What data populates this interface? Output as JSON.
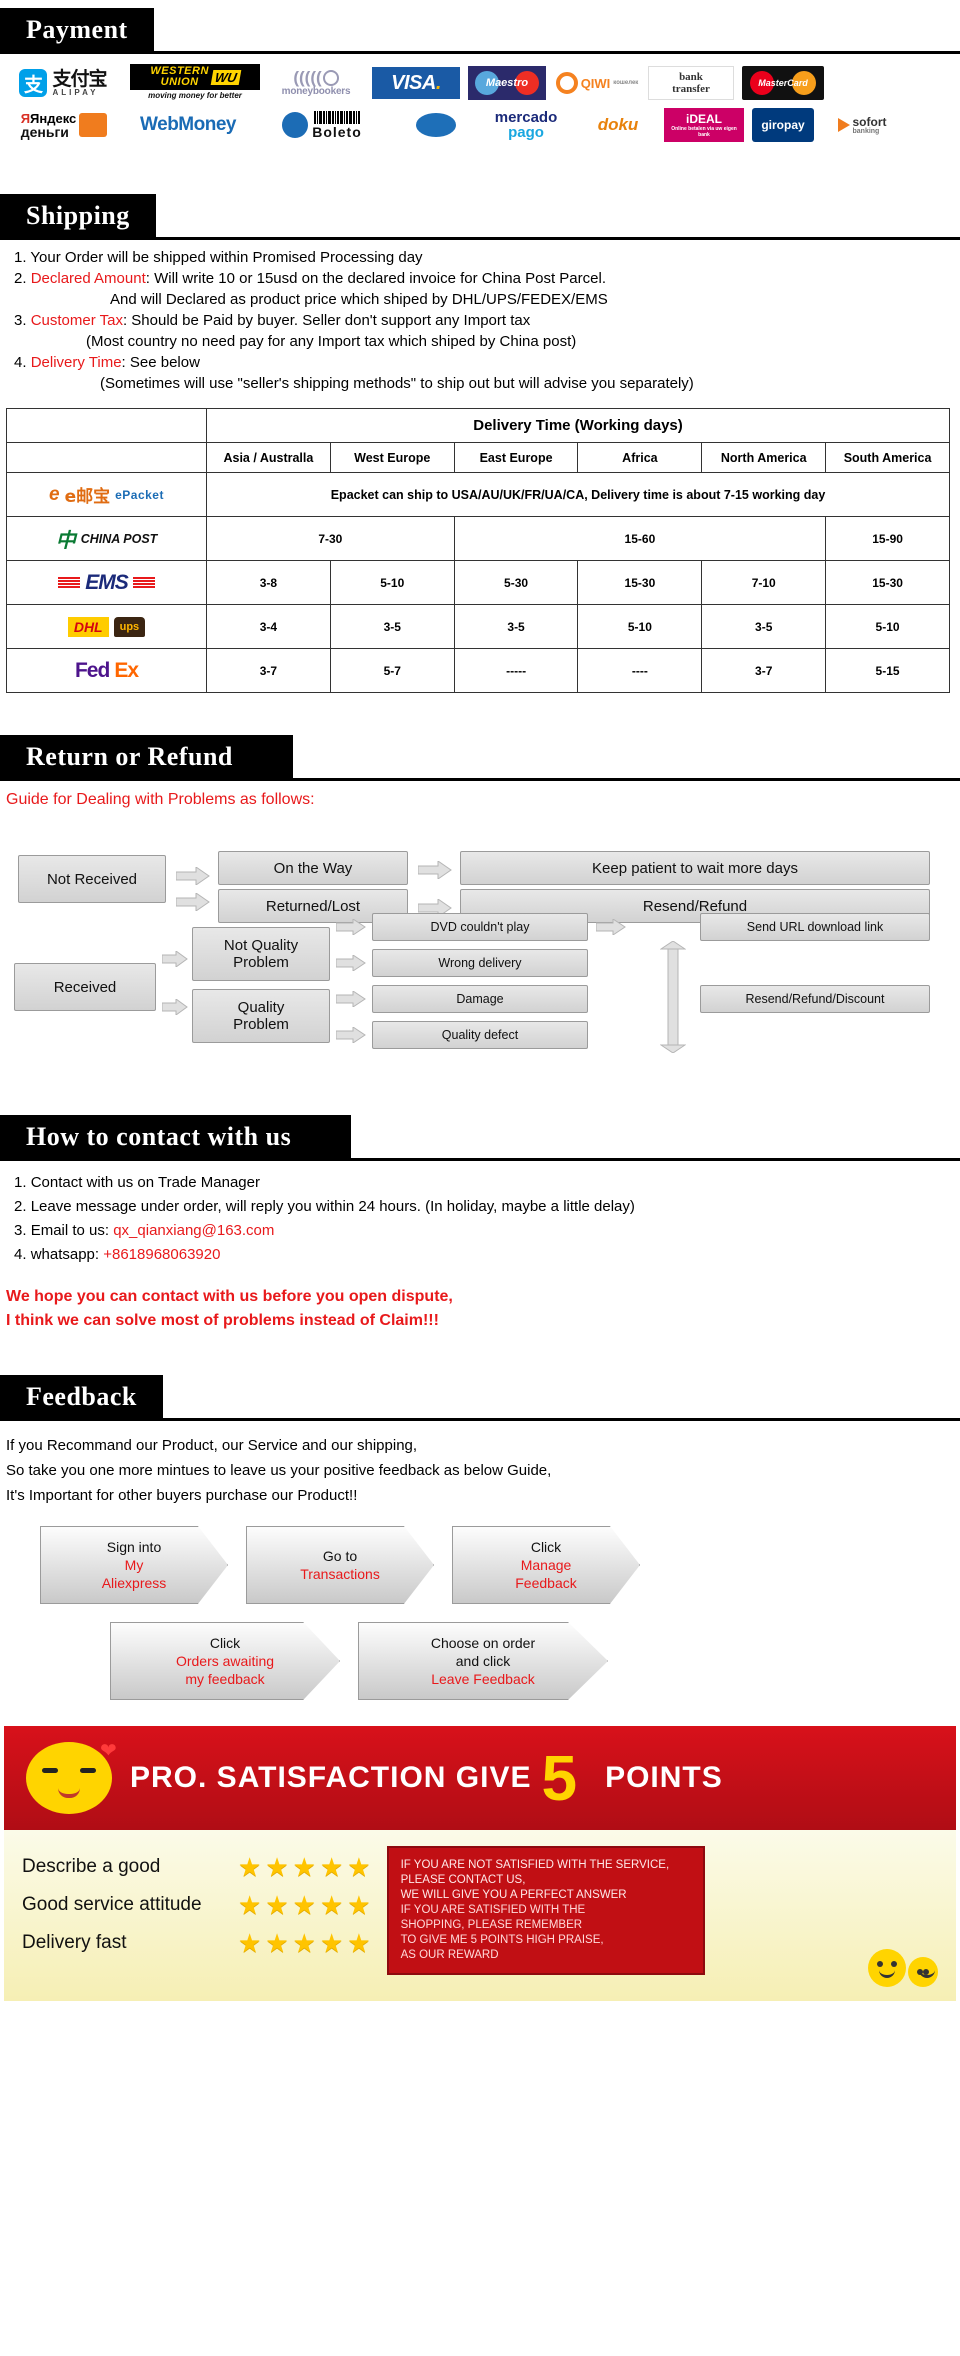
{
  "sections": {
    "payment": {
      "title": "Payment"
    },
    "shipping": {
      "title": "Shipping"
    },
    "return": {
      "title": "Return or Refund"
    },
    "contact": {
      "title": "How to contact with us"
    },
    "feedback": {
      "title": "Feedback"
    }
  },
  "payment": {
    "row1": [
      {
        "name": "alipay",
        "label": "ALIPAY",
        "cn": "支付宝",
        "glyph": "支"
      },
      {
        "name": "western-union",
        "line1": "WESTERN",
        "line2": "UNION",
        "mark": "WU",
        "caption": "moving money for better"
      },
      {
        "name": "moneybookers",
        "label": "moneybookers"
      },
      {
        "name": "visa",
        "label": "VISA"
      },
      {
        "name": "maestro",
        "label": "Maestro"
      },
      {
        "name": "qiwi",
        "label": "QIWI",
        "sub": "кошелек"
      },
      {
        "name": "bank-transfer",
        "line1": "bank",
        "line2": "transfer"
      },
      {
        "name": "mastercard",
        "label": "MasterCard"
      }
    ],
    "row2": [
      {
        "name": "yandex-dengi",
        "line1": "Яндекс",
        "line2": "деньги"
      },
      {
        "name": "webmoney",
        "label": "WebMoney"
      },
      {
        "name": "boleto",
        "label": "Boleto"
      },
      {
        "name": "mercado-pago",
        "line1": "mercado",
        "line2": "pago"
      },
      {
        "name": "doku",
        "label": "doku"
      },
      {
        "name": "ideal",
        "label": "iDEAL",
        "sub": "Online betalen via uw eigen bank"
      },
      {
        "name": "giropay",
        "label": "giropay"
      },
      {
        "name": "sofort",
        "line1": "sofort",
        "line2": "banking"
      }
    ]
  },
  "shipping": {
    "items": [
      {
        "num": "1.",
        "label": "",
        "text": "Your Order will be shipped within Promised Processing day"
      },
      {
        "num": "2.",
        "label": "Declared Amount",
        "text": ": Will write 10 or 15usd on the declared invoice for China Post Parcel."
      },
      {
        "num": "3.",
        "label": "Customer Tax",
        "text": ":  Should be Paid by buyer. Seller don't support any Import tax"
      },
      {
        "num": "4.",
        "label": "Delivery Time",
        "text": ": See below"
      }
    ],
    "sub1": "And will Declared as product price which shiped by DHL/UPS/FEDEX/EMS",
    "sub2": "(Most country no need pay for any Import tax which shiped by China post)",
    "sub3": "(Sometimes will use \"seller's shipping methods\" to ship out but will advise you separately)"
  },
  "delivery_table": {
    "title": "Delivery Time (Working days)",
    "columns": [
      "Asia / Australla",
      "West Europe",
      "East Europe",
      "Africa",
      "North America",
      "South America"
    ],
    "rows": [
      {
        "carrier": "ePacket",
        "carrier_cn": "e邮宝",
        "span_note": "Epacket can ship to USA/AU/UK/FR/UA/CA, Delivery time is about 7-15 working day",
        "values": []
      },
      {
        "carrier": "CHINA POST",
        "values": [
          "7-30",
          "7-30",
          "15-60",
          "15-60",
          "15-60",
          "15-90"
        ],
        "merged": [
          {
            "text": "7-30",
            "span": 2
          },
          {
            "text": "15-60",
            "span": 3
          },
          {
            "text": "15-90",
            "span": 1
          }
        ]
      },
      {
        "carrier": "EMS",
        "values": [
          "3-8",
          "5-10",
          "5-30",
          "15-30",
          "7-10",
          "15-30"
        ]
      },
      {
        "carrier": "DHL / UPS",
        "values": [
          "3-4",
          "3-5",
          "3-5",
          "5-10",
          "3-5",
          "5-10"
        ]
      },
      {
        "carrier": "FedEx",
        "values": [
          "3-7",
          "5-7",
          "-----",
          "----",
          "3-7",
          "5-15"
        ]
      }
    ]
  },
  "refund": {
    "guide": "Guide for Dealing with Problems as follows:",
    "not_received": "Not Received",
    "received": "Received",
    "on_the_way": "On the Way",
    "returned_lost": "Returned/Lost",
    "keep_patient": "Keep patient to wait more days",
    "resend_refund": "Resend/Refund",
    "not_quality_problem": "Not Quality\nProblem",
    "not_quality_l1": "Not Quality",
    "not_quality_l2": "Problem",
    "quality_l1": "Quality",
    "quality_l2": "Problem",
    "dvd": "DVD couldn't play",
    "wrong_delivery": "Wrong  delivery",
    "damage": "Damage",
    "quality_defect": "Quality defect",
    "send_url": "Send URL download link",
    "resend_refund_discount": "Resend/Refund/Discount"
  },
  "contact": {
    "items": [
      {
        "num": "1.",
        "text": "Contact with us on Trade Manager",
        "value": ""
      },
      {
        "num": "2.",
        "text": "Leave message under order, will reply you within 24 hours. (In holiday, maybe a little delay)",
        "value": ""
      },
      {
        "num": "3.",
        "text": "Email to us: ",
        "value": "qx_qianxiang@163.com"
      },
      {
        "num": "4.",
        "text": "whatsapp: ",
        "value": "+8618968063920"
      }
    ],
    "notice_line1": "We hope you can contact with us before you open dispute,",
    "notice_line2": "I think we can solve most of problems instead of Claim!!!"
  },
  "feedback": {
    "line1": "If you Recommand our Product, our Service and our shipping,",
    "line2": "So take you one more mintues to leave us your positive feedback as below Guide,",
    "line3": "It's Important for other buyers purchase our Product!!",
    "steps": [
      {
        "plain": "Sign into",
        "red1": "My",
        "red2": "Aliexpress"
      },
      {
        "plain": "Go to",
        "red1": "Transactions",
        "red2": ""
      },
      {
        "plain": "Click",
        "red1": "Manage",
        "red2": "Feedback"
      },
      {
        "plain": "Click",
        "red1": "Orders awaiting",
        "red2": "my feedback"
      },
      {
        "plain": "Choose on order",
        "plain2": "and click",
        "red1": "Leave Feedback",
        "red2": ""
      }
    ]
  },
  "promo": {
    "headline": "PRO. SATISFACTION GIVE",
    "five": "5",
    "points": "POINTS",
    "ratings": [
      {
        "label": "Describe a good",
        "stars": 5
      },
      {
        "label": "Good service attitude",
        "stars": 5
      },
      {
        "label": "Delivery fast",
        "stars": 5
      }
    ],
    "card": [
      "IF YOU ARE NOT SATISFIED WITH THE SERVICE, PLEASE CONTACT US,",
      "WE WILL GIVE YOU A PERFECT ANSWER",
      "IF YOU ARE SATISFIED WITH THE",
      "SHOPPING, PLEASE REMEMBER",
      "TO GIVE ME 5 POINTS HIGH PRAISE,",
      "AS OUR REWARD"
    ]
  },
  "colors": {
    "accent_red": "#e8191b",
    "banner_red": "#c10f14",
    "star_yellow": "#ffc400",
    "black": "#000000"
  }
}
